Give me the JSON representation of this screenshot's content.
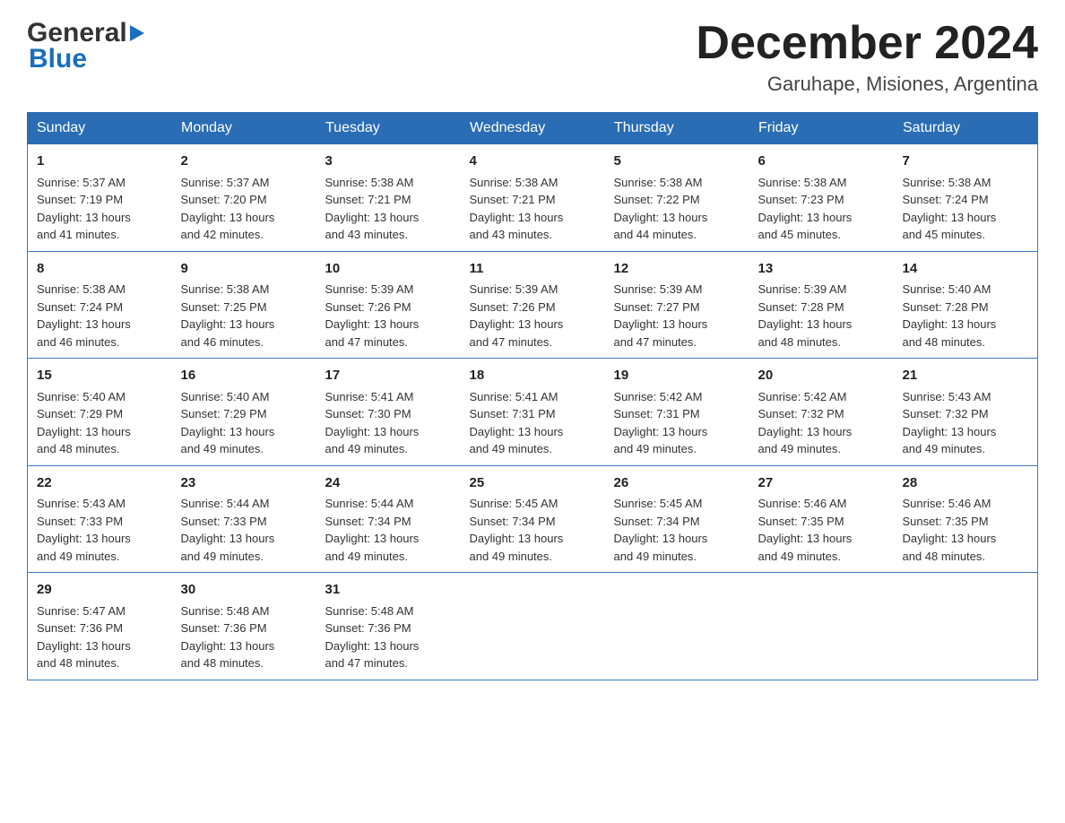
{
  "header": {
    "main_title": "December 2024",
    "subtitle": "Garuhape, Misiones, Argentina",
    "logo_general": "General",
    "logo_blue": "Blue"
  },
  "days_of_week": [
    "Sunday",
    "Monday",
    "Tuesday",
    "Wednesday",
    "Thursday",
    "Friday",
    "Saturday"
  ],
  "weeks": [
    [
      {
        "day": "1",
        "sunrise": "5:37 AM",
        "sunset": "7:19 PM",
        "daylight": "13 hours and 41 minutes."
      },
      {
        "day": "2",
        "sunrise": "5:37 AM",
        "sunset": "7:20 PM",
        "daylight": "13 hours and 42 minutes."
      },
      {
        "day": "3",
        "sunrise": "5:38 AM",
        "sunset": "7:21 PM",
        "daylight": "13 hours and 43 minutes."
      },
      {
        "day": "4",
        "sunrise": "5:38 AM",
        "sunset": "7:21 PM",
        "daylight": "13 hours and 43 minutes."
      },
      {
        "day": "5",
        "sunrise": "5:38 AM",
        "sunset": "7:22 PM",
        "daylight": "13 hours and 44 minutes."
      },
      {
        "day": "6",
        "sunrise": "5:38 AM",
        "sunset": "7:23 PM",
        "daylight": "13 hours and 45 minutes."
      },
      {
        "day": "7",
        "sunrise": "5:38 AM",
        "sunset": "7:24 PM",
        "daylight": "13 hours and 45 minutes."
      }
    ],
    [
      {
        "day": "8",
        "sunrise": "5:38 AM",
        "sunset": "7:24 PM",
        "daylight": "13 hours and 46 minutes."
      },
      {
        "day": "9",
        "sunrise": "5:38 AM",
        "sunset": "7:25 PM",
        "daylight": "13 hours and 46 minutes."
      },
      {
        "day": "10",
        "sunrise": "5:39 AM",
        "sunset": "7:26 PM",
        "daylight": "13 hours and 47 minutes."
      },
      {
        "day": "11",
        "sunrise": "5:39 AM",
        "sunset": "7:26 PM",
        "daylight": "13 hours and 47 minutes."
      },
      {
        "day": "12",
        "sunrise": "5:39 AM",
        "sunset": "7:27 PM",
        "daylight": "13 hours and 47 minutes."
      },
      {
        "day": "13",
        "sunrise": "5:39 AM",
        "sunset": "7:28 PM",
        "daylight": "13 hours and 48 minutes."
      },
      {
        "day": "14",
        "sunrise": "5:40 AM",
        "sunset": "7:28 PM",
        "daylight": "13 hours and 48 minutes."
      }
    ],
    [
      {
        "day": "15",
        "sunrise": "5:40 AM",
        "sunset": "7:29 PM",
        "daylight": "13 hours and 48 minutes."
      },
      {
        "day": "16",
        "sunrise": "5:40 AM",
        "sunset": "7:29 PM",
        "daylight": "13 hours and 49 minutes."
      },
      {
        "day": "17",
        "sunrise": "5:41 AM",
        "sunset": "7:30 PM",
        "daylight": "13 hours and 49 minutes."
      },
      {
        "day": "18",
        "sunrise": "5:41 AM",
        "sunset": "7:31 PM",
        "daylight": "13 hours and 49 minutes."
      },
      {
        "day": "19",
        "sunrise": "5:42 AM",
        "sunset": "7:31 PM",
        "daylight": "13 hours and 49 minutes."
      },
      {
        "day": "20",
        "sunrise": "5:42 AM",
        "sunset": "7:32 PM",
        "daylight": "13 hours and 49 minutes."
      },
      {
        "day": "21",
        "sunrise": "5:43 AM",
        "sunset": "7:32 PM",
        "daylight": "13 hours and 49 minutes."
      }
    ],
    [
      {
        "day": "22",
        "sunrise": "5:43 AM",
        "sunset": "7:33 PM",
        "daylight": "13 hours and 49 minutes."
      },
      {
        "day": "23",
        "sunrise": "5:44 AM",
        "sunset": "7:33 PM",
        "daylight": "13 hours and 49 minutes."
      },
      {
        "day": "24",
        "sunrise": "5:44 AM",
        "sunset": "7:34 PM",
        "daylight": "13 hours and 49 minutes."
      },
      {
        "day": "25",
        "sunrise": "5:45 AM",
        "sunset": "7:34 PM",
        "daylight": "13 hours and 49 minutes."
      },
      {
        "day": "26",
        "sunrise": "5:45 AM",
        "sunset": "7:34 PM",
        "daylight": "13 hours and 49 minutes."
      },
      {
        "day": "27",
        "sunrise": "5:46 AM",
        "sunset": "7:35 PM",
        "daylight": "13 hours and 49 minutes."
      },
      {
        "day": "28",
        "sunrise": "5:46 AM",
        "sunset": "7:35 PM",
        "daylight": "13 hours and 48 minutes."
      }
    ],
    [
      {
        "day": "29",
        "sunrise": "5:47 AM",
        "sunset": "7:36 PM",
        "daylight": "13 hours and 48 minutes."
      },
      {
        "day": "30",
        "sunrise": "5:48 AM",
        "sunset": "7:36 PM",
        "daylight": "13 hours and 48 minutes."
      },
      {
        "day": "31",
        "sunrise": "5:48 AM",
        "sunset": "7:36 PM",
        "daylight": "13 hours and 47 minutes."
      },
      null,
      null,
      null,
      null
    ]
  ],
  "labels": {
    "sunrise": "Sunrise:",
    "sunset": "Sunset:",
    "daylight": "Daylight:"
  },
  "colors": {
    "header_bg": "#2a6db5",
    "border": "#3a7abf",
    "accent_blue": "#1a6ebd"
  }
}
